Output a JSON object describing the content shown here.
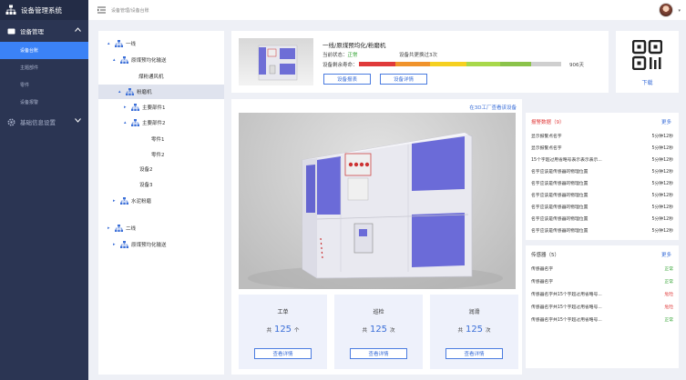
{
  "app": {
    "title": "设备管理系统"
  },
  "sidebar": {
    "group1": "设备管理",
    "items": [
      {
        "label": "设备台账"
      },
      {
        "label": "主题部件"
      },
      {
        "label": "零件"
      },
      {
        "label": "设备报警"
      }
    ],
    "group2": "基础信息设置"
  },
  "topbar": {
    "breadcrumb": "设备管理/设备台账"
  },
  "tree": {
    "n1": "一线",
    "n2": "原煤预均化输送",
    "n3": "煤粉通风机",
    "n4": "粉磨机",
    "n5": "主要部件1",
    "n6": "主要部件2",
    "n7": "零件1",
    "n8": "零件2",
    "n9": "设备2",
    "n10": "设备3",
    "n11": "水泥粉磨",
    "n12": "二线",
    "n13": "原煤预均化输送"
  },
  "device": {
    "title": "一线/原煤预均化/粉磨机",
    "status_label": "当前状态：",
    "status_value": "正常",
    "replaced_label": "设备共更换过3次",
    "life_label": "设备剩余寿命：",
    "life_days": "906天",
    "btn_report": "设备报表",
    "btn_detail": "设备详情",
    "download": "下载"
  },
  "colors": {
    "lifebar": [
      "#e03a3a",
      "#f0932b",
      "#f5d020",
      "#a8d84a",
      "#8bc34a",
      "#cfcfcf"
    ]
  },
  "viewer": {
    "link": "在3D工厂查看该设备"
  },
  "stats": [
    {
      "title": "工单",
      "prefix": "共",
      "value": "125",
      "unit": "个",
      "btn": "查看详情"
    },
    {
      "title": "巡检",
      "prefix": "共",
      "value": "125",
      "unit": "次",
      "btn": "查看详情"
    },
    {
      "title": "润滑",
      "prefix": "共",
      "value": "125",
      "unit": "次",
      "btn": "查看详情"
    }
  ],
  "alarms": {
    "title": "报警数据（9）",
    "more": "更多",
    "rows": [
      {
        "name": "显示报警点名字",
        "time": "5分钟12秒"
      },
      {
        "name": "显示报警点名字",
        "time": "5分钟12秒"
      },
      {
        "name": "15个字超过用省略号表示表示表示...",
        "time": "5分钟12秒"
      },
      {
        "name": "名字应该是传感器的物理位置",
        "time": "5分钟12秒"
      },
      {
        "name": "名字应该是传感器的物理位置",
        "time": "5分钟12秒"
      },
      {
        "name": "名字应该是传感器的物理位置",
        "time": "5分钟12秒"
      },
      {
        "name": "名字应该是传感器的物理位置",
        "time": "5分钟12秒"
      },
      {
        "name": "名字应该是传感器的物理位置",
        "time": "5分钟12秒"
      },
      {
        "name": "名字应该是传感器的物理位置",
        "time": "5分钟12秒"
      }
    ]
  },
  "sensors": {
    "title": "传感器（5）",
    "more": "更多",
    "rows": [
      {
        "name": "传感器名字",
        "status": "正常"
      },
      {
        "name": "传感器名字",
        "status": "正常"
      },
      {
        "name": "传感器名字共15个字超过用省略号...",
        "status": "危险"
      },
      {
        "name": "传感器名字共15个字超过用省略号...",
        "status": "危险"
      },
      {
        "name": "传感器名字共15个字超过用省略号...",
        "status": "正常"
      }
    ]
  }
}
